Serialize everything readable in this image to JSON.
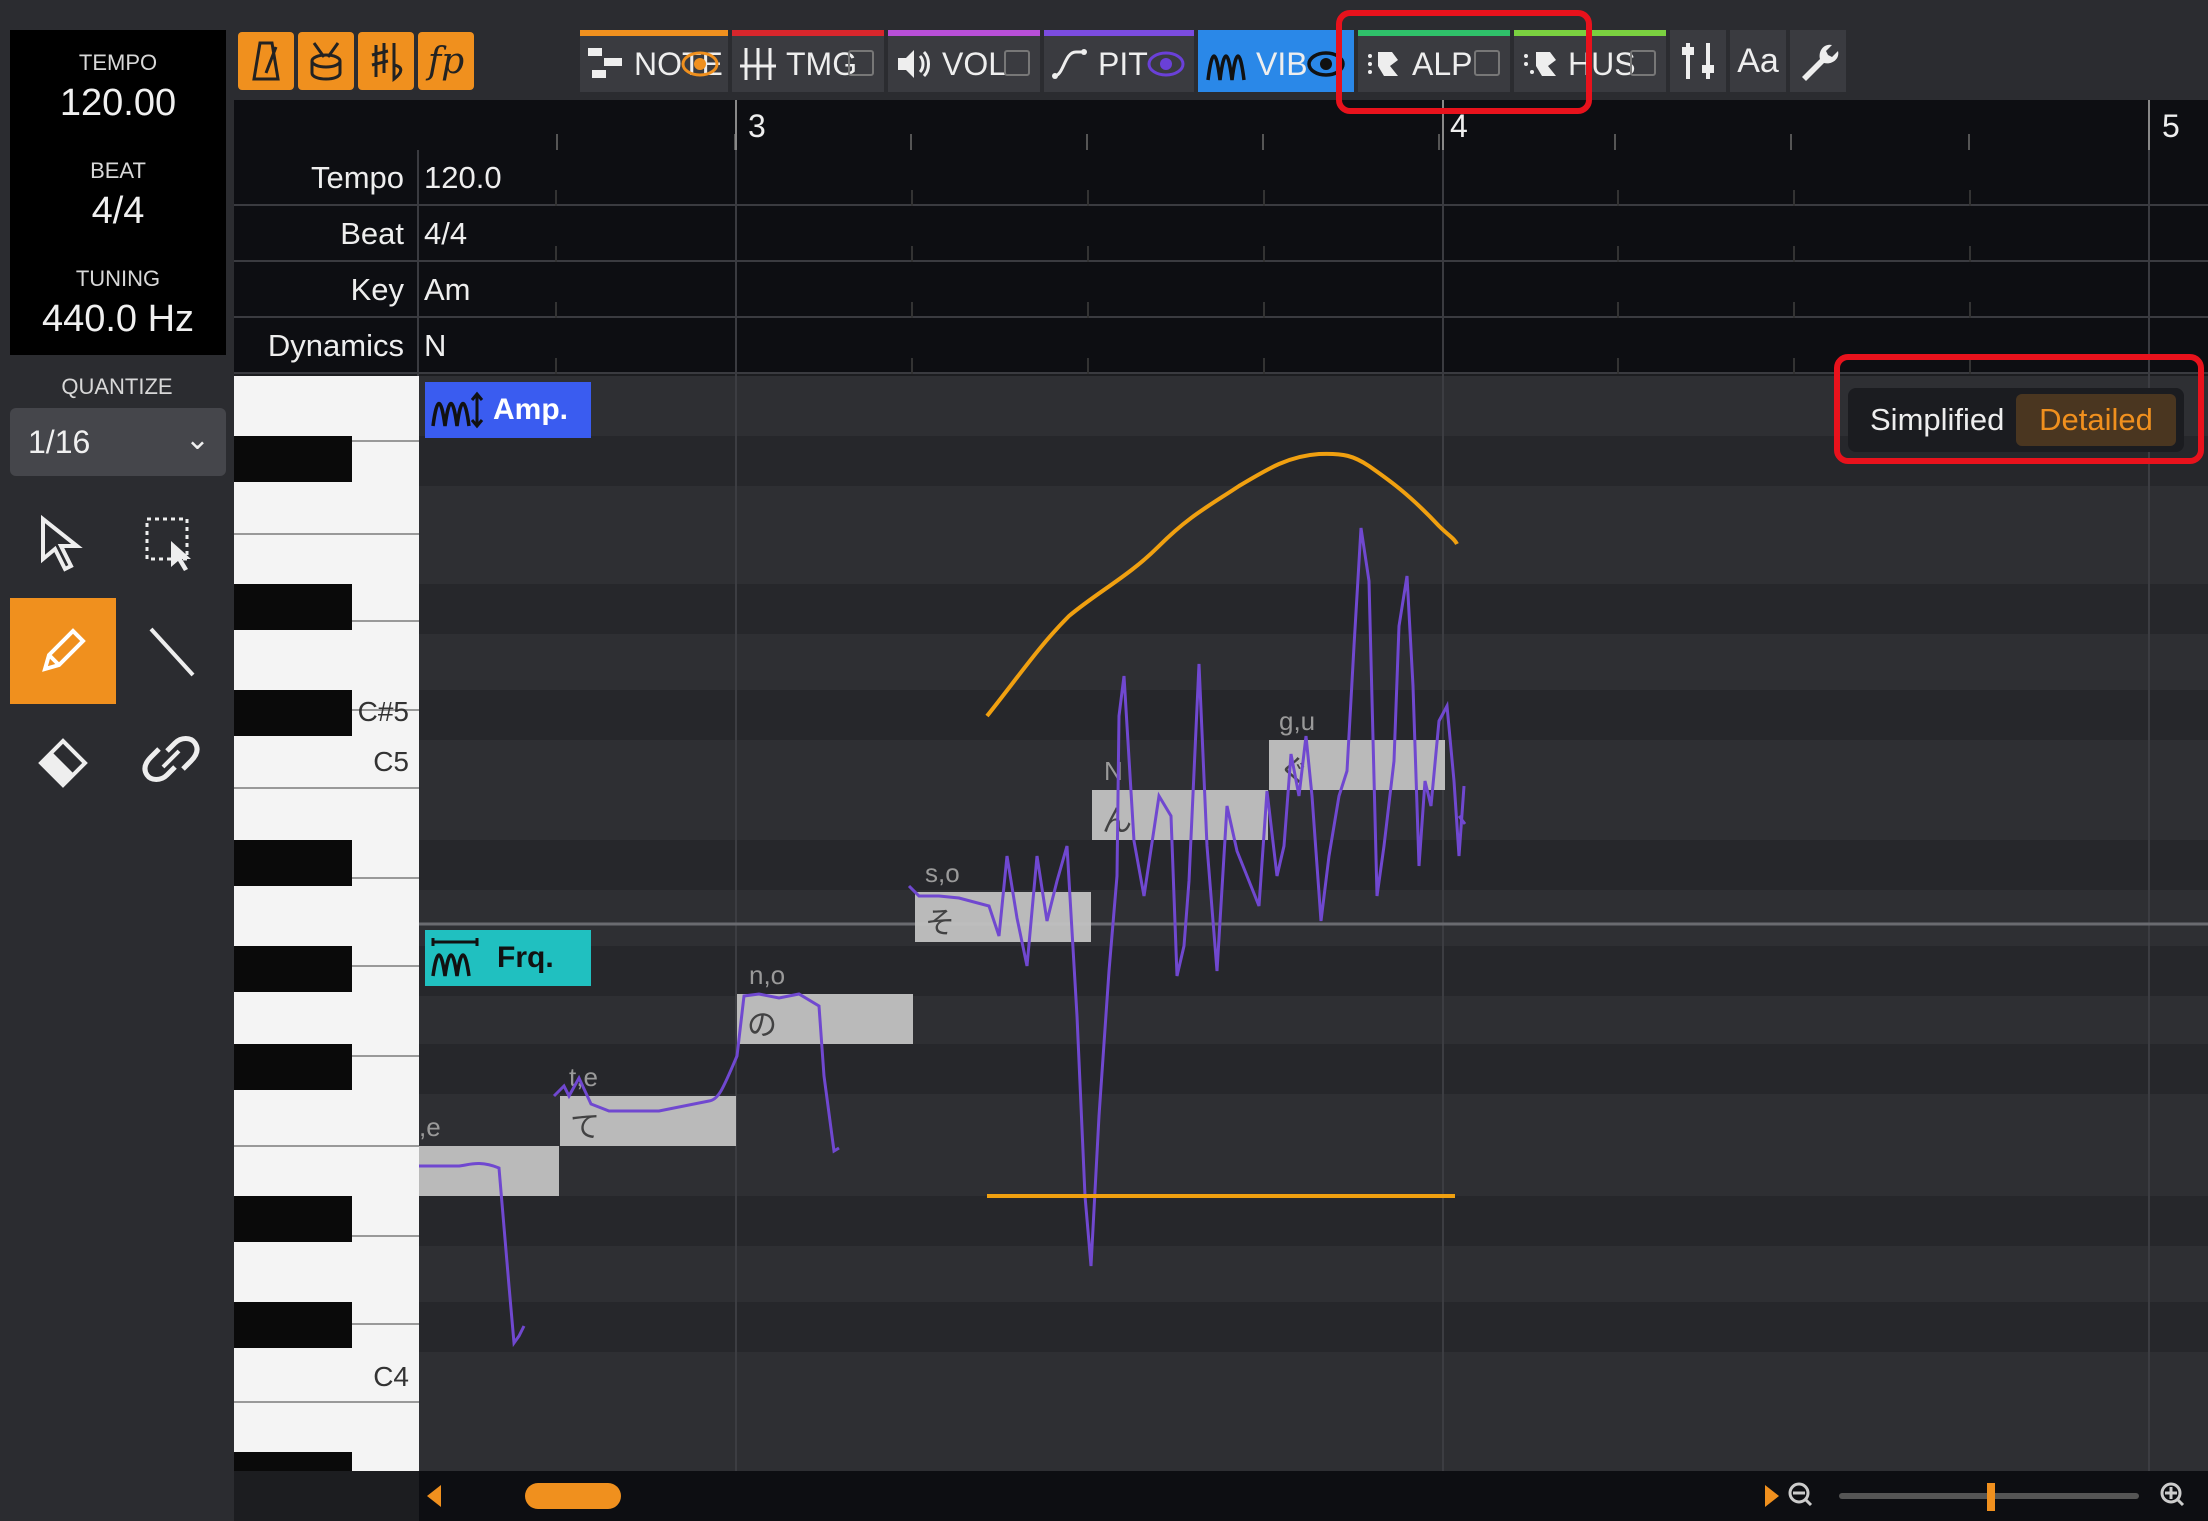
{
  "transport": {
    "tempo_label": "TEMPO",
    "tempo_value": "120.00",
    "beat_label": "BEAT",
    "beat_value": "4/4",
    "tuning_label": "TUNING",
    "tuning_value": "440.0 Hz"
  },
  "quantize": {
    "label": "QUANTIZE",
    "value": "1/16"
  },
  "tools": [
    "select-arrow-icon",
    "rect-select-icon",
    "pencil-icon",
    "line-icon",
    "eraser-icon",
    "link-icon"
  ],
  "toolbar": {
    "tabs": [
      {
        "label": "NOTE",
        "color": "#f0901e"
      },
      {
        "label": "TMG",
        "color": "#d8262c"
      },
      {
        "label": "VOL",
        "color": "#b84fd8"
      },
      {
        "label": "PIT",
        "color": "#7b4ce0"
      },
      {
        "label": "VIB",
        "color": "#2a88e8"
      },
      {
        "label": "ALP",
        "color": "#2fc06a"
      },
      {
        "label": "HUS",
        "color": "#7ad040"
      }
    ],
    "font_button": "Aa"
  },
  "ruler": {
    "bars": [
      "3",
      "4",
      "5"
    ]
  },
  "info_rows": [
    {
      "key": "Tempo",
      "value": "120.0"
    },
    {
      "key": "Beat",
      "value": "4/4"
    },
    {
      "key": "Key",
      "value": "Am"
    },
    {
      "key": "Dynamics",
      "value": "N"
    }
  ],
  "piano": {
    "labels": [
      "C#5",
      "C5",
      "C4"
    ]
  },
  "badges": {
    "amp": "Amp.",
    "frq": "Frq."
  },
  "view_mode": {
    "simplified": "Simplified",
    "detailed": "Detailed"
  },
  "notes": [
    {
      "phoneme": ",e",
      "lyric": ""
    },
    {
      "phoneme": "t,e",
      "lyric": "て"
    },
    {
      "phoneme": "n,o",
      "lyric": "の"
    },
    {
      "phoneme": "s,o",
      "lyric": "そ"
    },
    {
      "phoneme": "N",
      "lyric": "ん"
    },
    {
      "phoneme": "g,u",
      "lyric": "ぐ"
    }
  ],
  "colors": {
    "accent": "#f0901e",
    "vib_active": "#2a88e8",
    "pitch_curve": "#7048d0",
    "highlight": "#e8121c",
    "amp_badge": "#3a5cf0",
    "frq_badge": "#20c0c0"
  }
}
